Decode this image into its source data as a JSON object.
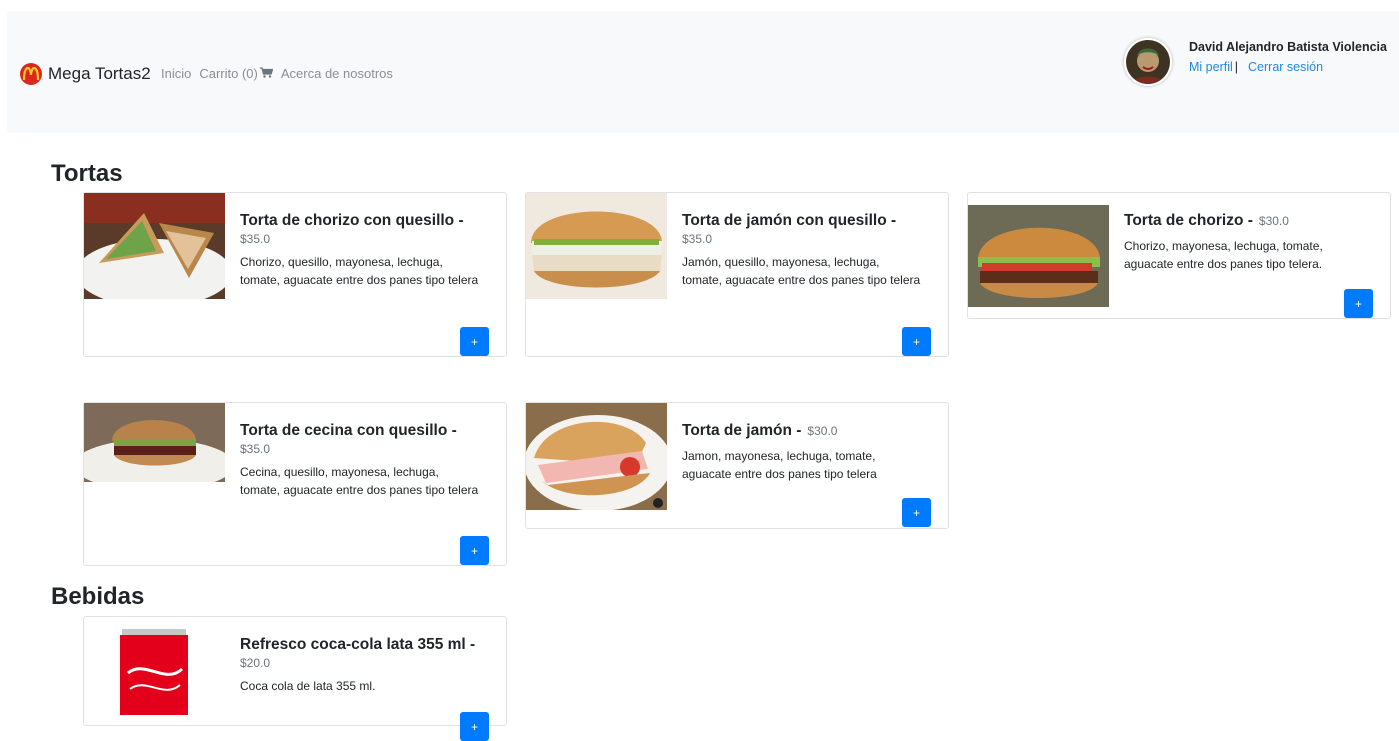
{
  "navbar": {
    "brand": "Mega Tortas2",
    "links": [
      "Inicio",
      "Carrito (0)",
      "Acerca de nosotros"
    ]
  },
  "user": {
    "name": "David Alejandro Batista Violencia",
    "profile_link": "Mi perfil",
    "separator": "|",
    "logout_link": "Cerrar sesión"
  },
  "sections": {
    "tortas": "Tortas",
    "bebidas": "Bebidas"
  },
  "products": [
    {
      "title": "Torta de chorizo con quesillo -",
      "price": "$35.0",
      "desc": "Chorizo, quesillo, mayonesa, lechuga, tomate, aguacate entre dos panes tipo telera"
    },
    {
      "title": "Torta de jamón con quesillo -",
      "price": "$35.0",
      "desc": "Jamón, quesillo, mayonesa, lechuga, tomate, aguacate entre dos panes tipo telera"
    },
    {
      "title": "Torta de chorizo -",
      "price": "$30.0",
      "desc": "Chorizo, mayonesa, lechuga, tomate, aguacate entre dos panes tipo telera."
    },
    {
      "title": "Torta de cecina con quesillo -",
      "price": "$35.0",
      "desc": "Cecina, quesillo, mayonesa, lechuga, tomate, aguacate entre dos panes tipo telera"
    },
    {
      "title": "Torta de jamón -",
      "price": "$30.0",
      "desc": "Jamon, mayonesa, lechuga, tomate, aguacate entre dos panes tipo telera"
    },
    {
      "title": "Refresco coca-cola lata 355 ml -",
      "price": "$20.0",
      "desc": "Coca cola de lata 355 ml."
    }
  ],
  "add_label": "+",
  "colors": {
    "accent": "#007bff",
    "link": "#1e88e5",
    "navbar_bg": "#f8f9fa",
    "brand_red": "#da291c",
    "brand_yellow": "#ffc72c"
  },
  "icons": {
    "brand": "mcdonalds-logo-icon",
    "cart": "cart-icon"
  }
}
